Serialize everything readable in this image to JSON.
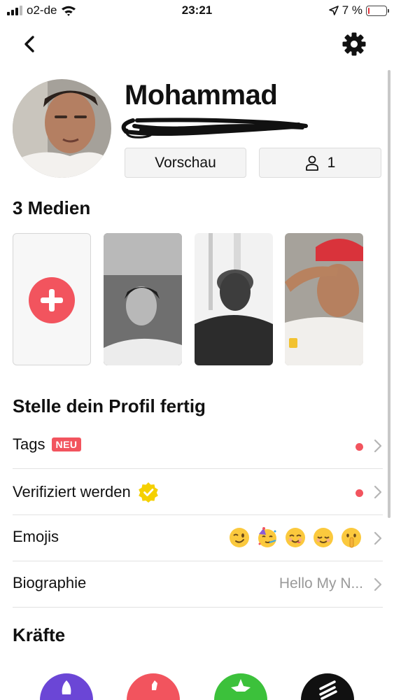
{
  "status_bar": {
    "carrier": "o2-de",
    "time": "23:21",
    "battery_percent": "7 %",
    "battery_level": 0.07,
    "signal_bars": 3,
    "icons": [
      "signal-icon",
      "wifi-icon",
      "location-arrow-icon",
      "battery-icon"
    ]
  },
  "nav": {
    "back_icon": "chevron-left-icon",
    "settings_icon": "gear-icon"
  },
  "profile": {
    "name": "Mohammad",
    "preview_button": "Vorschau",
    "followers_count": "1",
    "followers_icon": "person-icon"
  },
  "media": {
    "title": "3 Medien",
    "add_icon": "plus-icon"
  },
  "finish_profile": {
    "title": "Stelle dein Profil fertig",
    "rows": [
      {
        "label": "Tags",
        "badge": "NEU",
        "has_dot": true
      },
      {
        "label": "Verifiziert werden",
        "icon": "verified-badge-icon",
        "has_dot": true
      },
      {
        "label": "Emojis",
        "emojis": [
          "winking-face",
          "partying-face",
          "smiling-face",
          "relieved-face",
          "shushing-face"
        ]
      },
      {
        "label": "Biographie",
        "value": "Hello My N..."
      }
    ]
  },
  "powers": {
    "title": "Kräfte",
    "colors": [
      "#6b46d6",
      "#f2545e",
      "#3cc13b",
      "#111111"
    ]
  },
  "colors": {
    "accent": "#f2545e",
    "verified_yellow": "#f5d000"
  }
}
